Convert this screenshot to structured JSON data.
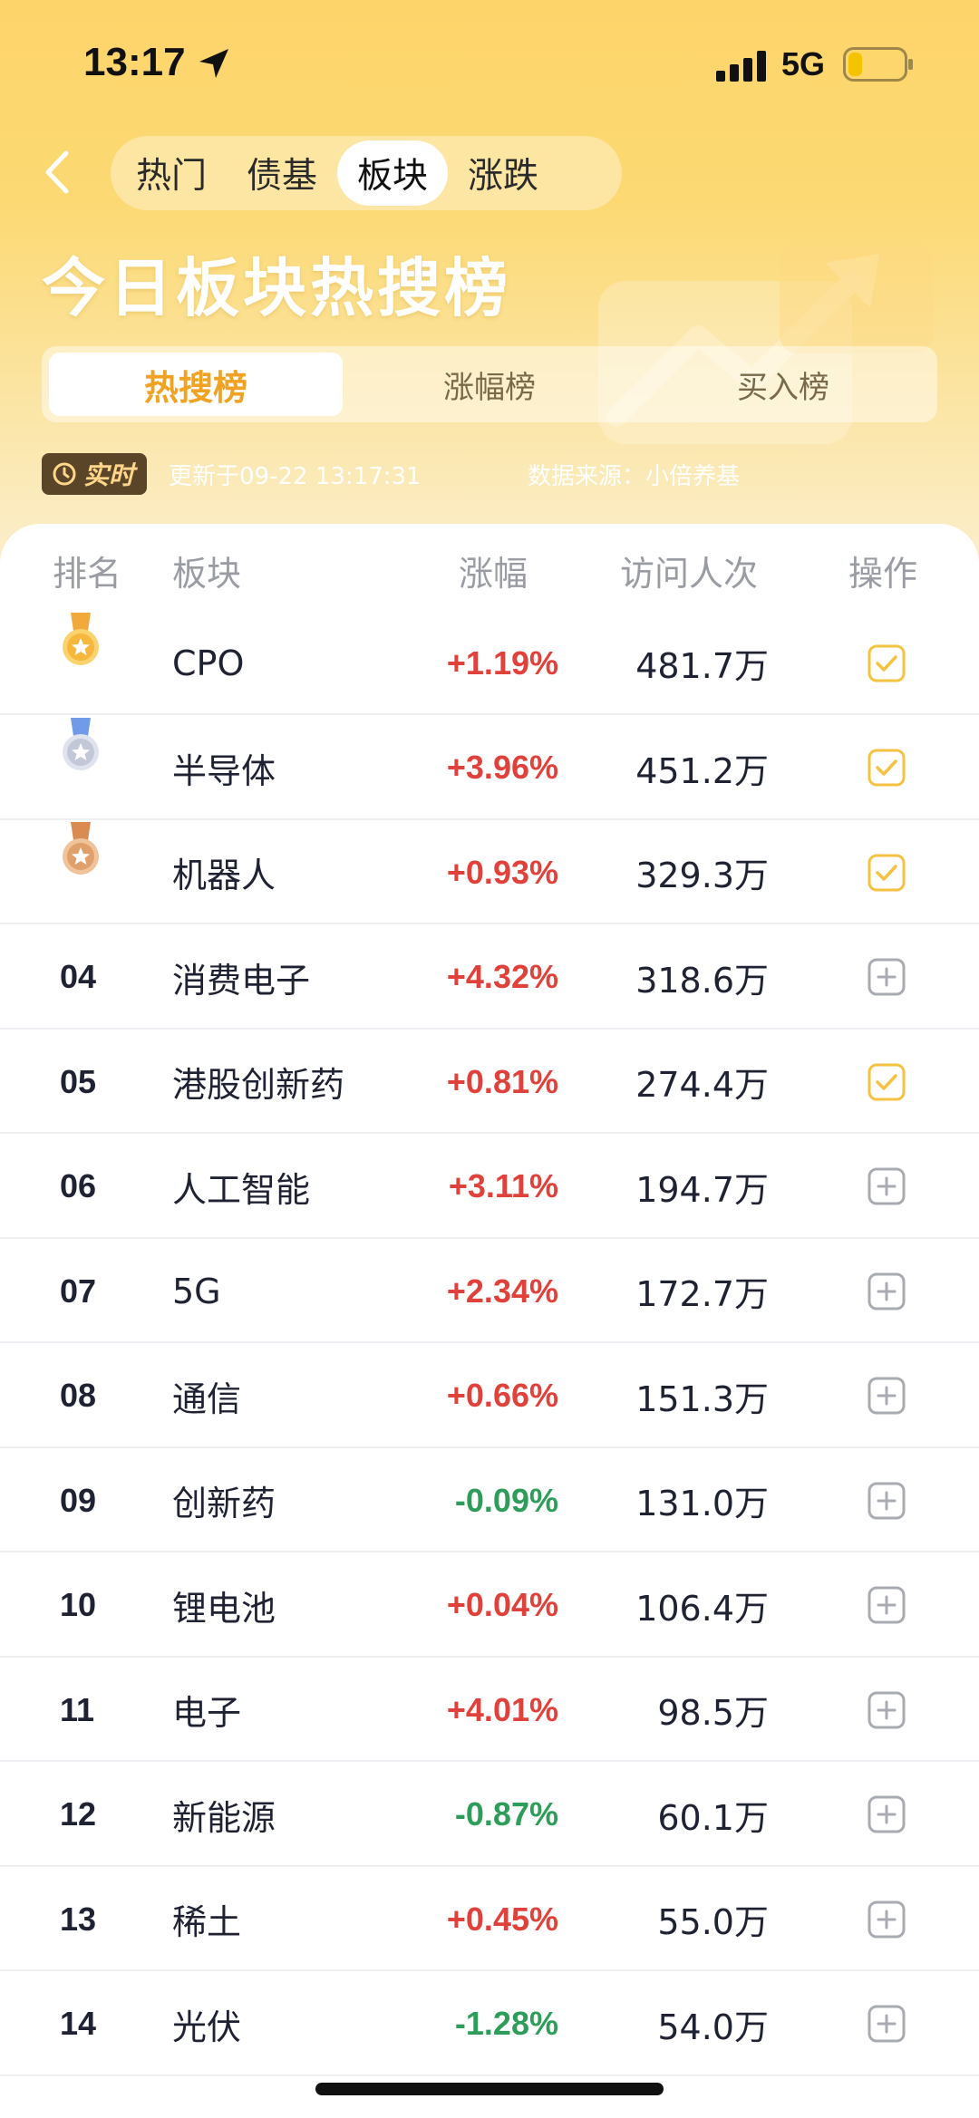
{
  "status_bar": {
    "time": "13:17",
    "network": "5G",
    "battery_level": 0.25
  },
  "nav": {
    "tabs": [
      {
        "label": "热门",
        "active": false
      },
      {
        "label": "债基",
        "active": false
      },
      {
        "label": "板块",
        "active": true
      },
      {
        "label": "涨跌",
        "active": false
      }
    ]
  },
  "page_title": "今日板块热搜榜",
  "sub_tabs": [
    {
      "label": "热搜榜",
      "active": true
    },
    {
      "label": "涨幅榜",
      "active": false
    },
    {
      "label": "买入榜",
      "active": false
    }
  ],
  "info": {
    "live_badge": "实时",
    "update_text": "更新于09-22 13:17:31",
    "source_text": "数据来源：小倍养基"
  },
  "table": {
    "headers": {
      "rank": "排名",
      "sector": "板块",
      "change": "涨幅",
      "visits": "访问人次",
      "action": "操作"
    },
    "rows": [
      {
        "rank": "01",
        "medal": "gold",
        "name": "CPO",
        "change": "+1.19%",
        "dir": "up",
        "visits": "481.7万",
        "added": true
      },
      {
        "rank": "02",
        "medal": "silver",
        "name": "半导体",
        "change": "+3.96%",
        "dir": "up",
        "visits": "451.2万",
        "added": true
      },
      {
        "rank": "03",
        "medal": "bronze",
        "name": "机器人",
        "change": "+0.93%",
        "dir": "up",
        "visits": "329.3万",
        "added": true
      },
      {
        "rank": "04",
        "medal": "",
        "name": "消费电子",
        "change": "+4.32%",
        "dir": "up",
        "visits": "318.6万",
        "added": false
      },
      {
        "rank": "05",
        "medal": "",
        "name": "港股创新药",
        "change": "+0.81%",
        "dir": "up",
        "visits": "274.4万",
        "added": true
      },
      {
        "rank": "06",
        "medal": "",
        "name": "人工智能",
        "change": "+3.11%",
        "dir": "up",
        "visits": "194.7万",
        "added": false
      },
      {
        "rank": "07",
        "medal": "",
        "name": "5G",
        "change": "+2.34%",
        "dir": "up",
        "visits": "172.7万",
        "added": false
      },
      {
        "rank": "08",
        "medal": "",
        "name": "通信",
        "change": "+0.66%",
        "dir": "up",
        "visits": "151.3万",
        "added": false
      },
      {
        "rank": "09",
        "medal": "",
        "name": "创新药",
        "change": "-0.09%",
        "dir": "down",
        "visits": "131.0万",
        "added": false
      },
      {
        "rank": "10",
        "medal": "",
        "name": "锂电池",
        "change": "+0.04%",
        "dir": "up",
        "visits": "106.4万",
        "added": false
      },
      {
        "rank": "11",
        "medal": "",
        "name": "电子",
        "change": "+4.01%",
        "dir": "up",
        "visits": "98.5万",
        "added": false
      },
      {
        "rank": "12",
        "medal": "",
        "name": "新能源",
        "change": "-0.87%",
        "dir": "down",
        "visits": "60.1万",
        "added": false
      },
      {
        "rank": "13",
        "medal": "",
        "name": "稀土",
        "change": "+0.45%",
        "dir": "up",
        "visits": "55.0万",
        "added": false
      },
      {
        "rank": "14",
        "medal": "",
        "name": "光伏",
        "change": "-1.28%",
        "dir": "down",
        "visits": "54.0万",
        "added": false
      }
    ]
  },
  "colors": {
    "up": "#e0413a",
    "down": "#2f9d5a",
    "accent": "#f0a322",
    "check": "#f5c242"
  }
}
